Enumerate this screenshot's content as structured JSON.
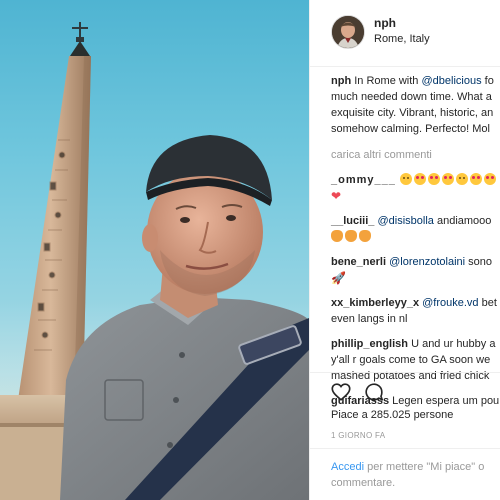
{
  "post": {
    "username": "nph",
    "location": "Rome, Italy",
    "caption": {
      "username": "nph",
      "line1_prefix": "In Rome with ",
      "line1_mention": "@dbelicious",
      "line1_suffix": " fo",
      "line2": "much needed down time. What a",
      "line3": "exquisite city. Vibrant, historic, an",
      "line4": "somehow calming. Perfecto! Mol"
    },
    "load_more": "carica altri commenti",
    "comments": [
      {
        "username": "_ommy___",
        "emoji": [
          "happy",
          "heart-eyes",
          "heart-eyes",
          "heart-eyes",
          "happy",
          "heart-eyes",
          "heart-eyes"
        ],
        "extra_line_heart": "❤"
      },
      {
        "username": "__luciii_",
        "mention": "@disisbolla",
        "text": " andiamooo",
        "emoji": [
          "cat",
          "cat",
          "cat"
        ]
      },
      {
        "username": "bene_nerli",
        "mention": "@lorenzotolaini",
        "text": " sono",
        "rocket": "🚀"
      },
      {
        "username": "xx_kimberleyy_x",
        "mention": "@frouke.vd",
        "text": " bet",
        "line2": "even langs in nl"
      },
      {
        "username": "phillip_english",
        "text": " U and ur hubby a",
        "line2": "y'all r goals come to GA soon we",
        "line3": "mashed potatoes and fried chick"
      },
      {
        "username": "guifariasss",
        "text": " Legen espera um pou"
      }
    ],
    "likes_text": "Piace a 285.025 persone",
    "time_ago": "1 GIORNO FA",
    "login": {
      "link": "Accedi",
      "text": " per mettere \"Mi piace\" o",
      "line2": "commentare."
    }
  },
  "colors": {
    "text": "#262626",
    "muted": "#999999",
    "link": "#3897f0",
    "mention": "#003569",
    "border": "#efefef",
    "sky": "#6fc6dd"
  },
  "icons": {
    "like": "heart-outline-icon",
    "comment": "speech-bubble-icon"
  }
}
